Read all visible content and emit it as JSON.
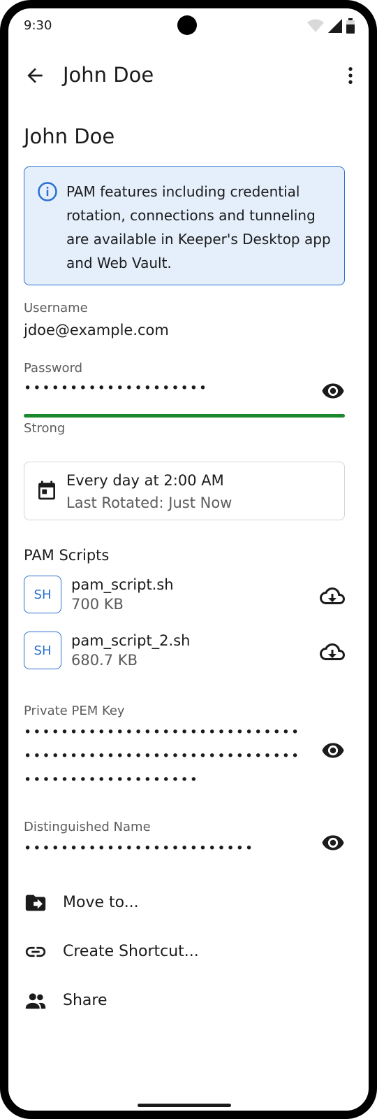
{
  "status_bar": {
    "time": "9:30"
  },
  "app_bar": {
    "title": "John Doe"
  },
  "page": {
    "title": "John Doe"
  },
  "info_banner": {
    "text": "PAM features including credential rotation, connections and tunneling are available in Keeper's Desktop app and Web Vault."
  },
  "fields": {
    "username": {
      "label": "Username",
      "value": "jdoe@example.com"
    },
    "password": {
      "label": "Password",
      "masked": "••••••••••••••••••••",
      "strength": "Strong",
      "strength_color": "#1a8a2d"
    },
    "rotation": {
      "schedule": "Every day at 2:00 AM",
      "last_rotated": "Last Rotated: Just Now"
    },
    "pem": {
      "label": "Private PEM Key",
      "line1": "••••••••••••••••••••••••••••••",
      "line2": "••••••••••••••••••••••••••••••",
      "line3": "•••••••••••••••••••"
    },
    "dn": {
      "label": "Distinguished Name",
      "masked": "•••••••••••••••••••••••••"
    }
  },
  "scripts": {
    "title": "PAM Scripts",
    "items": [
      {
        "badge": "SH",
        "name": "pam_script.sh",
        "size": "700 KB"
      },
      {
        "badge": "SH",
        "name": "pam_script_2.sh",
        "size": "680.7 KB"
      }
    ]
  },
  "actions": {
    "move": "Move to...",
    "shortcut": "Create Shortcut...",
    "share": "Share"
  },
  "colors": {
    "accent": "#2b6fcf",
    "banner_bg": "#e4effb",
    "strength": "#1a8a2d"
  }
}
